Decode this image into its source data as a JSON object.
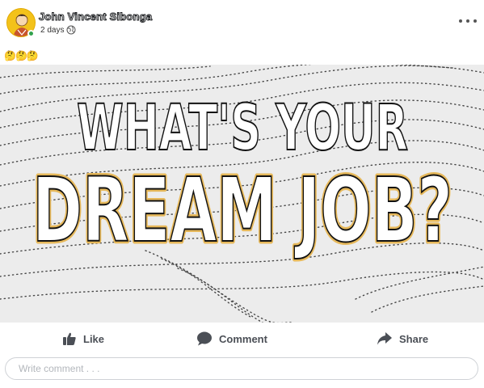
{
  "post": {
    "author_name": "John Vincent Sibonga",
    "timestamp": "2 days",
    "audience_icon": "globe-icon",
    "body_emojis": "🤔🤔🤔",
    "more_icon": "more-horizontal-icon"
  },
  "image": {
    "line1": "WHAT'S YOUR",
    "line2": "DREAM JOB?"
  },
  "actions": {
    "like_label": "Like",
    "comment_label": "Comment",
    "share_label": "Share"
  },
  "comment_box": {
    "placeholder": "Write comment . . ."
  },
  "colors": {
    "avatar_bg": "#f3c21a",
    "online": "#31a24c",
    "action_text": "#4b4f56",
    "image_bg": "#eeeeee"
  }
}
